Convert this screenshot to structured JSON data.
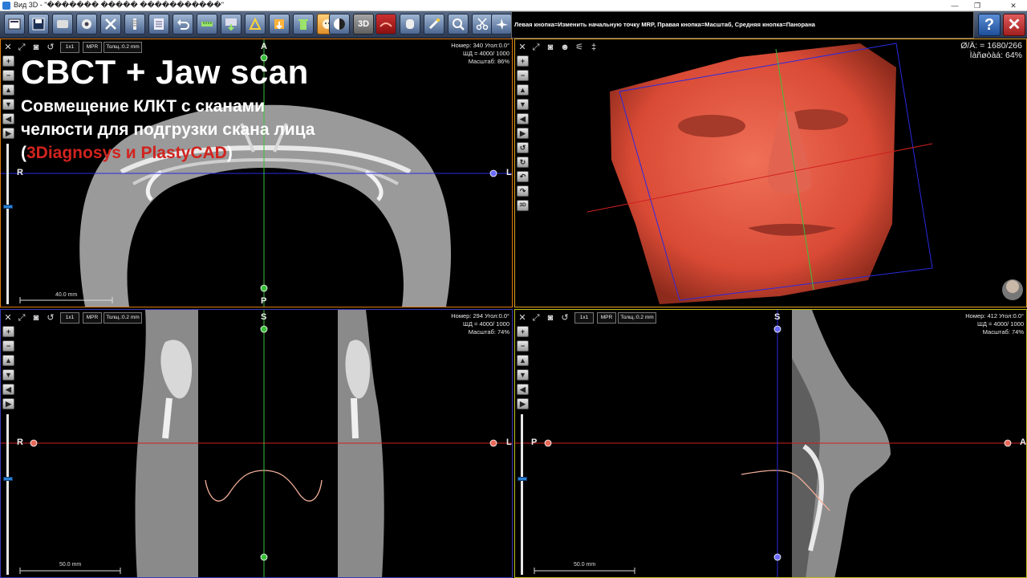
{
  "window": {
    "title": "Вид 3D  -  \"������� ����� �����������\"",
    "minimize": "—",
    "maximize": "❐",
    "close": "✕"
  },
  "toolbar": {
    "btn_3d": "3D",
    "hint": "Левая кнопка=Изменить начальную точку MRP, Правая кнопка=Масштаб, Средняя кнопка=Панорана",
    "help": "?",
    "close": "✕"
  },
  "viewports": {
    "axial": {
      "zoom_1x1": "1x1",
      "mpr": "MPR",
      "thickness": "Толщ.:0.2 mm",
      "info_line1": "Номер: 340 Угол:0.0°",
      "info_line2": "ШД = 4000/ 1000",
      "info_line3": "Масштаб: 86%",
      "orient_top": "A",
      "orient_bottom": "P",
      "orient_left": "R",
      "orient_right": "L",
      "scale": "40.0 mm",
      "slider_level": 0.62
    },
    "volume": {
      "info_line1": "Ø/Ä: = 1680/266",
      "info_line2": "Ìàñøòàá: 64%",
      "btn_3d": "3D"
    },
    "coronal": {
      "zoom_1x1": "1x1",
      "mpr": "MPR",
      "thickness": "Толщ.:0.2 mm",
      "info_line1": "Номер: 294 Угол:0.0°",
      "info_line2": "ШД = 4000/ 1000",
      "info_line3": "Масштаб: 74%",
      "orient_top": "S",
      "orient_left": "R",
      "orient_right": "L",
      "scale": "50.0 mm",
      "slider_level": 0.61
    },
    "sagittal": {
      "zoom_1x1": "1x1",
      "mpr": "MPR",
      "thickness": "Толщ.:0.2 mm",
      "info_line1": "Номер: 412 Угол:0.0°",
      "info_line2": "ШД = 4000/ 1000",
      "info_line3": "Масштаб: 74%",
      "orient_top": "S",
      "orient_left": "P",
      "orient_right": "A",
      "scale": "50.0 mm",
      "slider_level": 0.61
    }
  },
  "overlay": {
    "title": "CBCT + Jaw scan",
    "subtitle": "Совмещение КЛКТ с сканами челюсти для подгрузки скана лица",
    "paren_open": "(",
    "brands": "3Diagnosys и PlastyCAD",
    "paren_close": ")"
  },
  "colors": {
    "crosshair_green": "#3cc03c",
    "crosshair_blue": "#2a2ae0",
    "crosshair_red": "#d02020",
    "face_red": "#d94a35",
    "brand_red": "#d1231e"
  }
}
